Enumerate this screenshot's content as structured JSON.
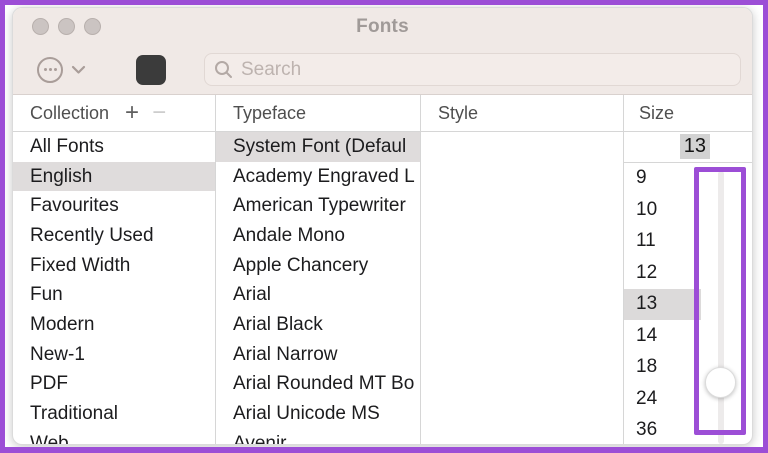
{
  "colors": {
    "annotation_purple": "#9c4ed6",
    "titlebar_bg": "#f0e9e6",
    "selection_gray": "#dfdcdc",
    "swatch_dark": "#3b3b3b"
  },
  "window": {
    "title": "Fonts"
  },
  "toolbar": {
    "search_placeholder": "Search"
  },
  "header": {
    "collection": "Collection",
    "add": "+",
    "remove": "−",
    "typeface": "Typeface",
    "style": "Style",
    "size": "Size"
  },
  "collections": [
    {
      "label": "All Fonts",
      "selected": false
    },
    {
      "label": "English",
      "selected": true
    },
    {
      "label": "Favourites",
      "selected": false
    },
    {
      "label": "Recently Used",
      "selected": false
    },
    {
      "label": "Fixed Width",
      "selected": false
    },
    {
      "label": "Fun",
      "selected": false
    },
    {
      "label": "Modern",
      "selected": false
    },
    {
      "label": "New-1",
      "selected": false
    },
    {
      "label": "PDF",
      "selected": false
    },
    {
      "label": "Traditional",
      "selected": false
    },
    {
      "label": "Web",
      "selected": false
    }
  ],
  "typefaces": [
    {
      "label": "System Font (Defaul",
      "selected": true
    },
    {
      "label": "Academy Engraved L",
      "selected": false
    },
    {
      "label": "American Typewriter",
      "selected": false
    },
    {
      "label": "Andale Mono",
      "selected": false
    },
    {
      "label": "Apple Chancery",
      "selected": false
    },
    {
      "label": "Arial",
      "selected": false
    },
    {
      "label": "Arial Black",
      "selected": false
    },
    {
      "label": "Arial Narrow",
      "selected": false
    },
    {
      "label": "Arial Rounded MT Bo",
      "selected": false
    },
    {
      "label": "Arial Unicode MS",
      "selected": false
    },
    {
      "label": "Avenir",
      "selected": false
    }
  ],
  "sizes": {
    "field_value": "13",
    "list": [
      {
        "label": "9",
        "selected": false
      },
      {
        "label": "10",
        "selected": false
      },
      {
        "label": "11",
        "selected": false
      },
      {
        "label": "12",
        "selected": false
      },
      {
        "label": "13",
        "selected": true
      },
      {
        "label": "14",
        "selected": false
      },
      {
        "label": "18",
        "selected": false
      },
      {
        "label": "24",
        "selected": false
      },
      {
        "label": "36",
        "selected": false
      }
    ]
  }
}
